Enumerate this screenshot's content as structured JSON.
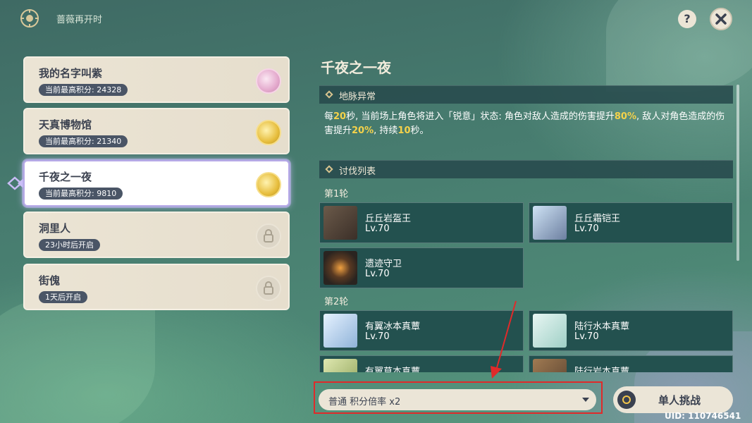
{
  "header": {
    "event_title": "蔷薇再开时"
  },
  "stages": [
    {
      "name": "我的名字叫紫",
      "badge": "当前最高积分: 24328",
      "icon": "pink-flower-medal-icon"
    },
    {
      "name": "天真博物馆",
      "badge": "当前最高积分: 21340",
      "icon": "gold-flower-medal-icon"
    },
    {
      "name": "千夜之一夜",
      "badge": "当前最高积分: 9810",
      "icon": "gold-flower-medal-icon",
      "selected": true
    },
    {
      "name": "洞里人",
      "badge": "23小时后开启",
      "icon": "lock-icon"
    },
    {
      "name": "街傀",
      "badge": "1天后开启",
      "icon": "lock-icon"
    }
  ],
  "detail": {
    "title": "千夜之一夜",
    "ley_line": {
      "header": "地脉异常",
      "parts": [
        {
          "text": "每",
          "hl": false
        },
        {
          "text": "20",
          "hl": true
        },
        {
          "text": "秒, 当前场上角色将进入「锐意」状态: 角色对敌人造成的伤害提升",
          "hl": false
        },
        {
          "text": "80%",
          "hl": true
        },
        {
          "text": ", 敌人对角色造成的伤害提升",
          "hl": false
        },
        {
          "text": "20%",
          "hl": true
        },
        {
          "text": ", 持续",
          "hl": false
        },
        {
          "text": "10",
          "hl": true
        },
        {
          "text": "秒。",
          "hl": false
        }
      ]
    },
    "enemy_list": {
      "header": "讨伐列表",
      "waves": [
        {
          "label": "第1轮",
          "enemies": [
            {
              "name": "丘丘岩盔王",
              "level": "Lv.70"
            },
            {
              "name": "丘丘霜铠王",
              "level": "Lv.70"
            },
            {
              "name": "遗迹守卫",
              "level": "Lv.70"
            }
          ]
        },
        {
          "label": "第2轮",
          "enemies": [
            {
              "name": "有翼冰本真蕈",
              "level": "Lv.70"
            },
            {
              "name": "陆行水本真蕈",
              "level": "Lv.70"
            },
            {
              "name": "有翼草本真蕈",
              "level": ""
            },
            {
              "name": "陆行岩本真蕈",
              "level": ""
            }
          ]
        }
      ]
    }
  },
  "footer": {
    "difficulty": "普通 积分倍率 x2",
    "start_label": "单人挑战",
    "uid": "UID: 110746541"
  },
  "colors": {
    "highlight": "#f5d24a",
    "annotation_red": "#e02a2a",
    "selected_border": "#b7a9e8"
  }
}
